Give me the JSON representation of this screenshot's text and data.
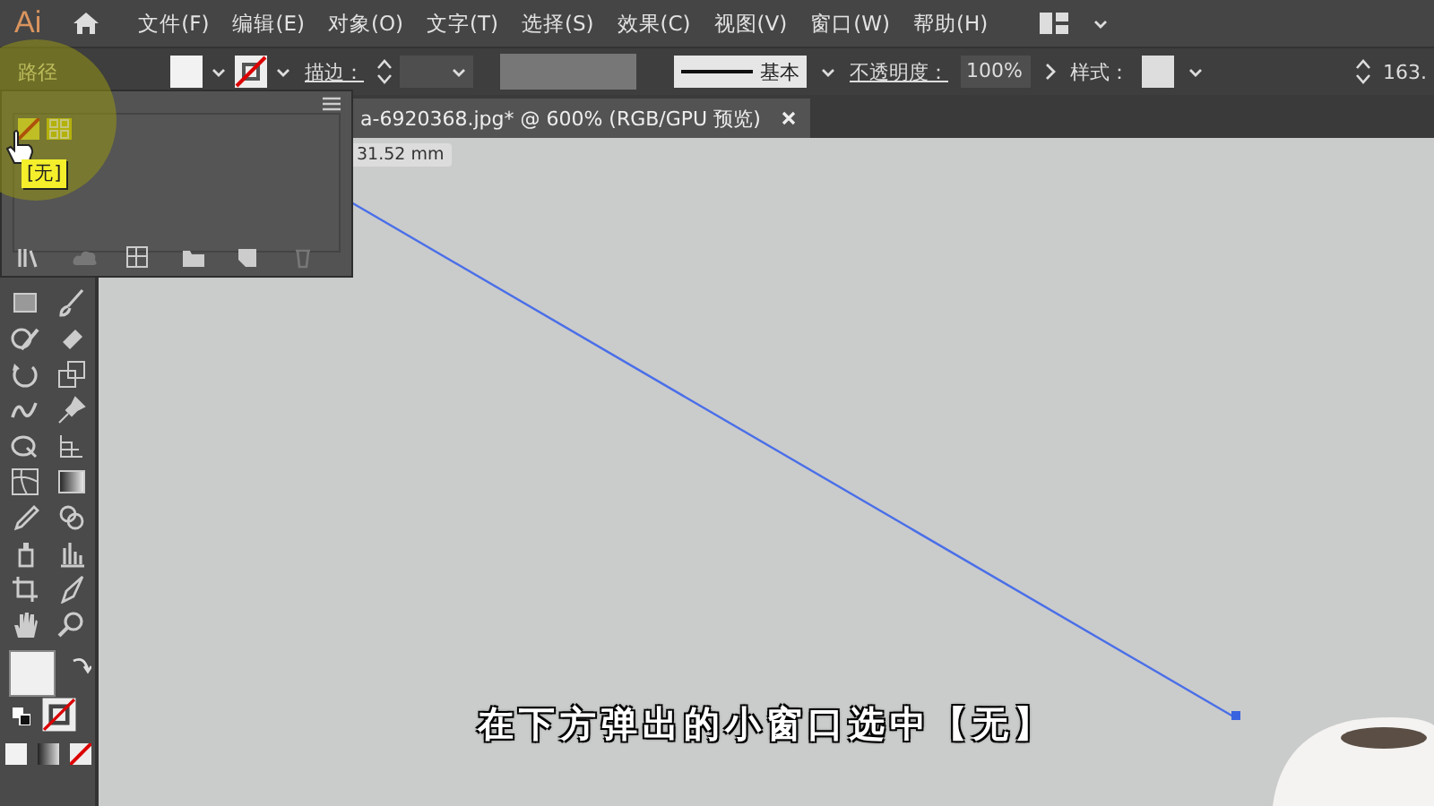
{
  "menubar": {
    "app_logo": "Ai",
    "menus": [
      "文件(F)",
      "编辑(E)",
      "对象(O)",
      "文字(T)",
      "选择(S)",
      "效果(C)",
      "视图(V)",
      "窗口(W)",
      "帮助(H)"
    ]
  },
  "control_bar": {
    "object_type": "路径",
    "stroke_label": "描边：",
    "brush_label": "基本",
    "opacity_label": "不透明度：",
    "opacity_value": "100%",
    "style_label": "样式：",
    "size_value": "163."
  },
  "document_tab": {
    "title": "a-6920368.jpg* @ 600% (RGB/GPU 预览)"
  },
  "measure_tooltip": "31.52 mm",
  "swatch_popup": {
    "tooltip": "[无]"
  },
  "subtitle": "在下方弹出的小窗口选中【无】"
}
